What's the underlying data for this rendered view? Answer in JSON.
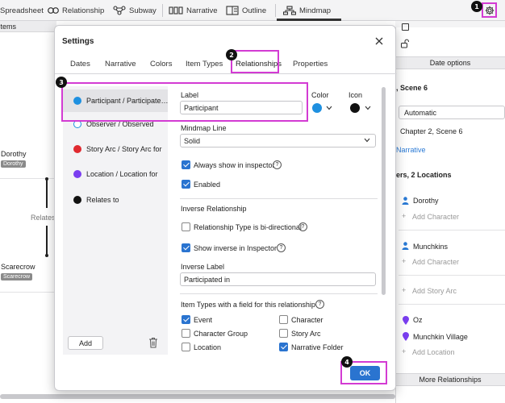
{
  "toolbar": {
    "items": [
      {
        "label": "Spreadsheet",
        "icon": "spreadsheet-icon"
      },
      {
        "label": "Relationship",
        "icon": "relationship-icon"
      },
      {
        "label": "Subway",
        "icon": "subway-icon"
      },
      {
        "label": "Narrative",
        "icon": "narrative-icon"
      },
      {
        "label": "Outline",
        "icon": "outline-icon"
      },
      {
        "label": "Mindmap",
        "icon": "mindmap-icon"
      }
    ],
    "active": "Mindmap"
  },
  "left_panel": {
    "header": "Items",
    "nodes": [
      {
        "name": "Dorothy",
        "tag": "Dorothy"
      },
      {
        "name": "Scarecrow",
        "tag": "Scarecrow"
      }
    ],
    "edge_label": "Relates"
  },
  "right_panel": {
    "section_date": "Date options",
    "scene_header": ", Scene 6",
    "date_mode": "Automatic",
    "chapter_scene": "Chapter 2, Scene 6",
    "narrative_link": "Narrative",
    "counts": "ers, 2 Locations",
    "characters": [
      "Dorothy",
      "Munchkins"
    ],
    "add_character": "Add Character",
    "add_story_arc": "Add Story Arc",
    "locations": [
      "Oz",
      "Munchkin Village"
    ],
    "add_location": "Add Location",
    "more": "More Relationships"
  },
  "dialog": {
    "title": "Settings",
    "tabs": [
      "Dates",
      "Narrative",
      "Colors",
      "Item Types",
      "Relationships",
      "Properties"
    ],
    "active_tab": "Relationships",
    "relationships": [
      {
        "label": "Participant / Participate…",
        "color": "#1e90e0",
        "ring": false
      },
      {
        "label": "Observer / Observed",
        "color": "#ffffff",
        "ring": true
      },
      {
        "label": "Story Arc / Story Arc for",
        "color": "#e0292f",
        "ring": false
      },
      {
        "label": "Location / Location for",
        "color": "#7a3ef0",
        "ring": false
      },
      {
        "label": "Relates to",
        "color": "#111111",
        "ring": false
      }
    ],
    "add_label": "Add",
    "form": {
      "label_title": "Label",
      "label_value": "Participant",
      "color_title": "Color",
      "color_value": "#1e90e0",
      "icon_title": "Icon",
      "icon_value": "#111111",
      "mindmap_line_title": "Mindmap Line",
      "mindmap_line_value": "Solid",
      "always_show": "Always show in inspector",
      "always_show_checked": true,
      "enabled": "Enabled",
      "enabled_checked": true,
      "inverse_title": "Inverse Relationship",
      "bidirectional": "Relationship Type is bi-directional",
      "bidirectional_checked": false,
      "show_inverse": "Show inverse in Inspector",
      "show_inverse_checked": true,
      "inverse_label_title": "Inverse Label",
      "inverse_label_value": "Participated in",
      "item_types_title": "Item Types with a field for this relationship",
      "item_types": [
        {
          "label": "Event",
          "checked": true
        },
        {
          "label": "Character",
          "checked": false
        },
        {
          "label": "Character Group",
          "checked": false
        },
        {
          "label": "Story Arc",
          "checked": false
        },
        {
          "label": "Location",
          "checked": false
        },
        {
          "label": "Narrative Folder",
          "checked": true
        }
      ]
    },
    "ok_label": "OK"
  },
  "badges": [
    "1",
    "2",
    "3",
    "4"
  ],
  "colors": {
    "highlight": "#d33bd3",
    "accent": "#2a74d0"
  }
}
